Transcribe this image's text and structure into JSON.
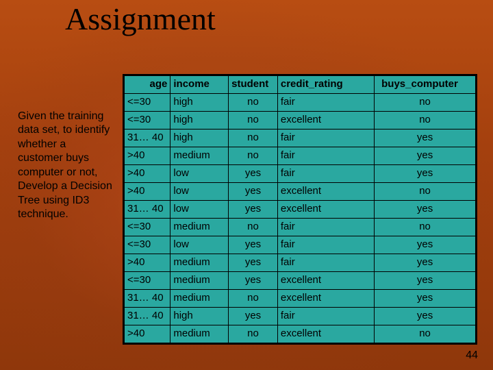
{
  "slide": {
    "title": "Assignment",
    "description": "Given the training data set, to identify whether a customer buys computer or not, Develop a Decision Tree using ID3 technique.",
    "page_number": "44"
  },
  "chart_data": {
    "type": "table",
    "columns": [
      "age",
      "income",
      "student",
      "credit_rating",
      "buys_computer"
    ],
    "rows": [
      {
        "age": "<=30",
        "income": "high",
        "student": "no",
        "credit_rating": "fair",
        "buys_computer": "no"
      },
      {
        "age": "<=30",
        "income": "high",
        "student": "no",
        "credit_rating": "excellent",
        "buys_computer": "no"
      },
      {
        "age": "31… 40",
        "income": "high",
        "student": "no",
        "credit_rating": "fair",
        "buys_computer": "yes"
      },
      {
        "age": ">40",
        "income": "medium",
        "student": "no",
        "credit_rating": "fair",
        "buys_computer": "yes"
      },
      {
        "age": ">40",
        "income": "low",
        "student": "yes",
        "credit_rating": "fair",
        "buys_computer": "yes"
      },
      {
        "age": ">40",
        "income": "low",
        "student": "yes",
        "credit_rating": "excellent",
        "buys_computer": "no"
      },
      {
        "age": "31… 40",
        "income": "low",
        "student": "yes",
        "credit_rating": "excellent",
        "buys_computer": "yes"
      },
      {
        "age": "<=30",
        "income": "medium",
        "student": "no",
        "credit_rating": "fair",
        "buys_computer": "no"
      },
      {
        "age": "<=30",
        "income": "low",
        "student": "yes",
        "credit_rating": "fair",
        "buys_computer": "yes"
      },
      {
        "age": ">40",
        "income": "medium",
        "student": "yes",
        "credit_rating": "fair",
        "buys_computer": "yes"
      },
      {
        "age": "<=30",
        "income": "medium",
        "student": "yes",
        "credit_rating": "excellent",
        "buys_computer": "yes"
      },
      {
        "age": "31… 40",
        "income": "medium",
        "student": "no",
        "credit_rating": "excellent",
        "buys_computer": "yes"
      },
      {
        "age": "31… 40",
        "income": "high",
        "student": "yes",
        "credit_rating": "fair",
        "buys_computer": "yes"
      },
      {
        "age": ">40",
        "income": "medium",
        "student": "no",
        "credit_rating": "excellent",
        "buys_computer": "no"
      }
    ]
  }
}
